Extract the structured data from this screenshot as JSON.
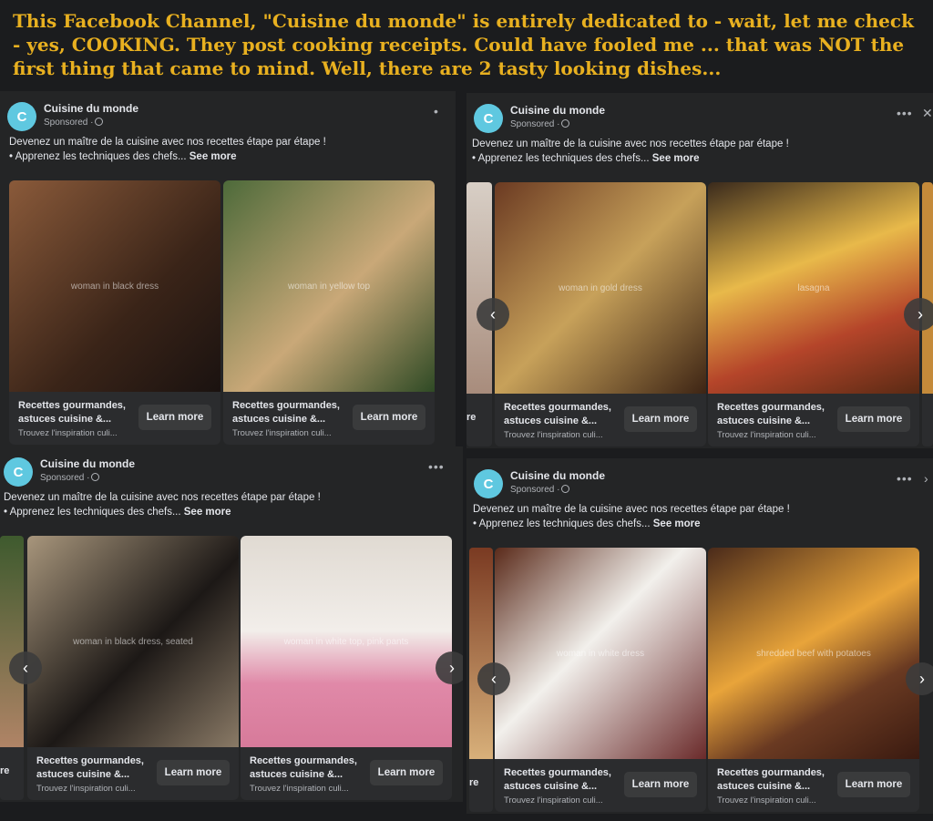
{
  "caption": "This  Facebook Channel, \"Cuisine du monde\" is entirely dedicated to - wait, let me check - yes, COOKING. They post cooking receipts. Could have fooled me ... that was NOT the first thing that came to mind. Well, there are 2 tasty looking dishes...",
  "post": {
    "avatar_letter": "C",
    "page_name": "Cuisine du monde",
    "sponsored": "Sponsored ·",
    "text_line1": "Devenez un maître de la cuisine avec nos recettes étape par étape !",
    "text_line2": "• Apprenez les techniques des chefs...",
    "see_more": "See more",
    "more_icon": "•••",
    "close_icon": "✕",
    "card_title": "Recettes gourmandes, astuces cuisine &...",
    "card_subtitle": "Trouvez l'inspiration culi...",
    "learn_more": "Learn more",
    "stub_text": "re",
    "prev_icon": "‹",
    "next_icon": "›"
  },
  "images": {
    "woman_black_dress": "woman in black dress",
    "woman_yellow_top": "woman in yellow top",
    "woman_gold_dress": "woman in gold dress",
    "lasagna": "lasagna",
    "woman_black_sitting": "woman in black dress, seated",
    "woman_pink_pants": "woman in white top, pink pants",
    "woman_white_dress": "woman in white dress",
    "beef_potatoes": "shredded beef with potatoes"
  },
  "colors": {
    "caption": "#e8b020",
    "avatar": "#5fc8e0",
    "post_bg": "#242526",
    "button_bg": "#3a3b3c"
  }
}
